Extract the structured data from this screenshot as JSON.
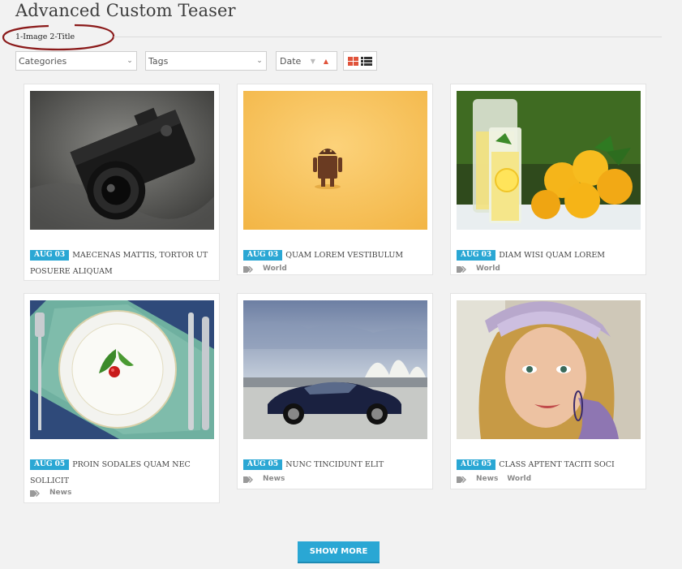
{
  "page": {
    "title": "Advanced Custom Teaser",
    "subtitle": "1-Image 2-Title"
  },
  "filters": {
    "categories": {
      "label": "Categories"
    },
    "tags": {
      "label": "Tags"
    },
    "date": {
      "label": "Date"
    }
  },
  "colors": {
    "accent": "#2aa7d4",
    "sort_active": "#e0533b",
    "oval": "#8b1a1a"
  },
  "cards": [
    {
      "date": "AUG 03",
      "title": "MAECENAS MATTIS, TORTOR UT POSUERE ALIQUAM",
      "tags": [],
      "image": "camera"
    },
    {
      "date": "AUG 03",
      "title": "QUAM LOREM VESTIBULUM",
      "tags": [
        "World"
      ],
      "image": "android-figure"
    },
    {
      "date": "AUG 03",
      "title": "DIAM WISI QUAM LOREM",
      "tags": [
        "World"
      ],
      "image": "lemonade"
    },
    {
      "date": "AUG 05",
      "title": "PROIN SODALES QUAM NEC SOLLICIT",
      "tags": [
        "News"
      ],
      "image": "plate"
    },
    {
      "date": "AUG 05",
      "title": "NUNC TINCIDUNT ELIT",
      "tags": [
        "News"
      ],
      "image": "car-opera-house"
    },
    {
      "date": "AUG 05",
      "title": "CLASS APTENT TACITI SOCI",
      "tags": [
        "News",
        "World"
      ],
      "image": "woman-portrait"
    }
  ],
  "actions": {
    "show_more": "SHOW MORE"
  }
}
